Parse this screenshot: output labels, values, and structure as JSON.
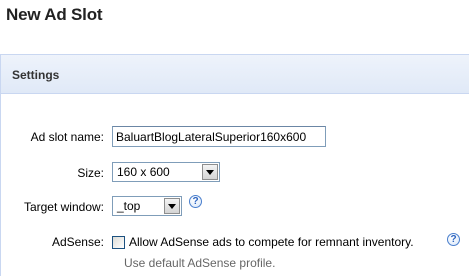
{
  "page": {
    "title": "New Ad Slot"
  },
  "settings": {
    "header": "Settings",
    "ad_slot_name": {
      "label": "Ad slot name:",
      "value": "BaluartBlogLateralSuperior160x600"
    },
    "size": {
      "label": "Size:",
      "value": "160 x 600"
    },
    "target_window": {
      "label": "Target window:",
      "value": "_top",
      "help": "?"
    },
    "adsense": {
      "label": "AdSense:",
      "checkbox_label": "Allow AdSense ads to compete for remnant inventory.",
      "checked": false,
      "help": "?",
      "hint": "Use default AdSense profile."
    }
  },
  "icons": {
    "help": "help-icon",
    "dropdown": "chevron-down-icon"
  },
  "colors": {
    "header_bg": "#e0e9f7",
    "border": "#c9d7f1",
    "help_icon": "#2d64c0",
    "hint_text": "#666666"
  }
}
